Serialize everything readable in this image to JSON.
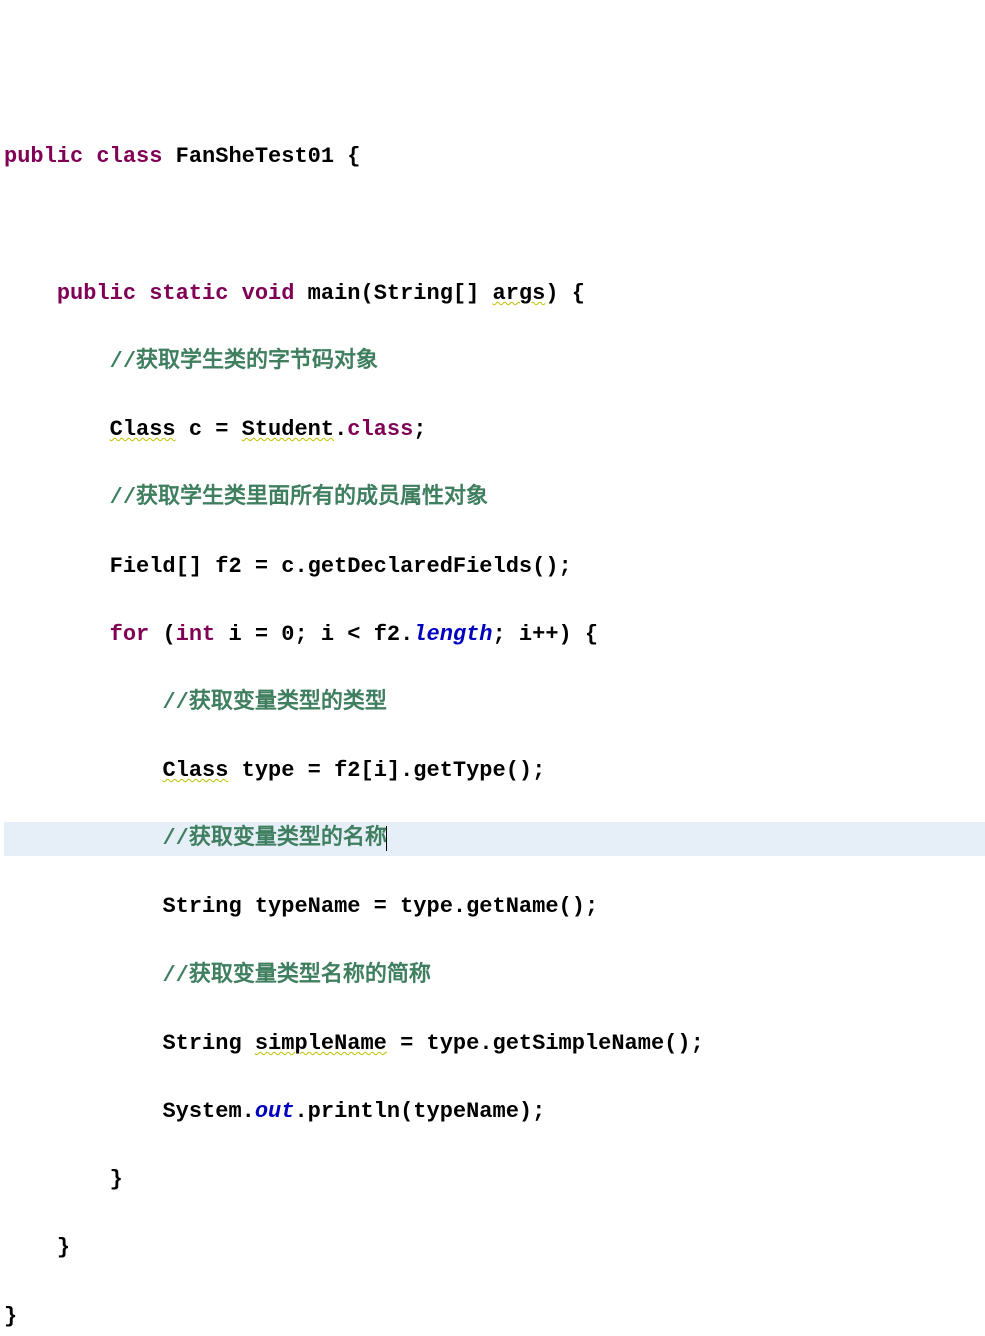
{
  "kw": {
    "public": "public",
    "class": "class",
    "static": "static",
    "void": "void",
    "for": "for",
    "int": "int"
  },
  "ids": {
    "className": "FanSheTest01",
    "mainName": "main",
    "String": "String",
    "args": "args",
    "Class": "Class",
    "c": "c",
    "Student": "Student",
    "classKw": "class",
    "Field": "Field",
    "f2": "f2",
    "getDeclaredFields": "getDeclaredFields",
    "i": "i",
    "zero": "0",
    "length": "length",
    "type": "type",
    "getType": "getType",
    "typeName": "typeName",
    "getName": "getName",
    "simpleName": "simpleName",
    "getSimpleName": "getSimpleName",
    "System": "System",
    "out": "out",
    "println": "println"
  },
  "cm": {
    "c1": "//获取学生类的字节码对象",
    "c2": "//获取学生类里面所有的成员属性对象",
    "c3": "//获取变量类型的类型",
    "c4": "//获取变量类型的名称",
    "c5": "//获取变量类型名称的简称"
  },
  "punct": {
    "obr": " {",
    "cbr": "}",
    "sq": "[]",
    "op": "(",
    "cp": ")",
    "semi": ";",
    "eq": " = ",
    "dot": ".",
    "pp": "++",
    "lt": " < ",
    "comma": "; ",
    "osq": "[",
    "csq": "]",
    "sp": " "
  }
}
